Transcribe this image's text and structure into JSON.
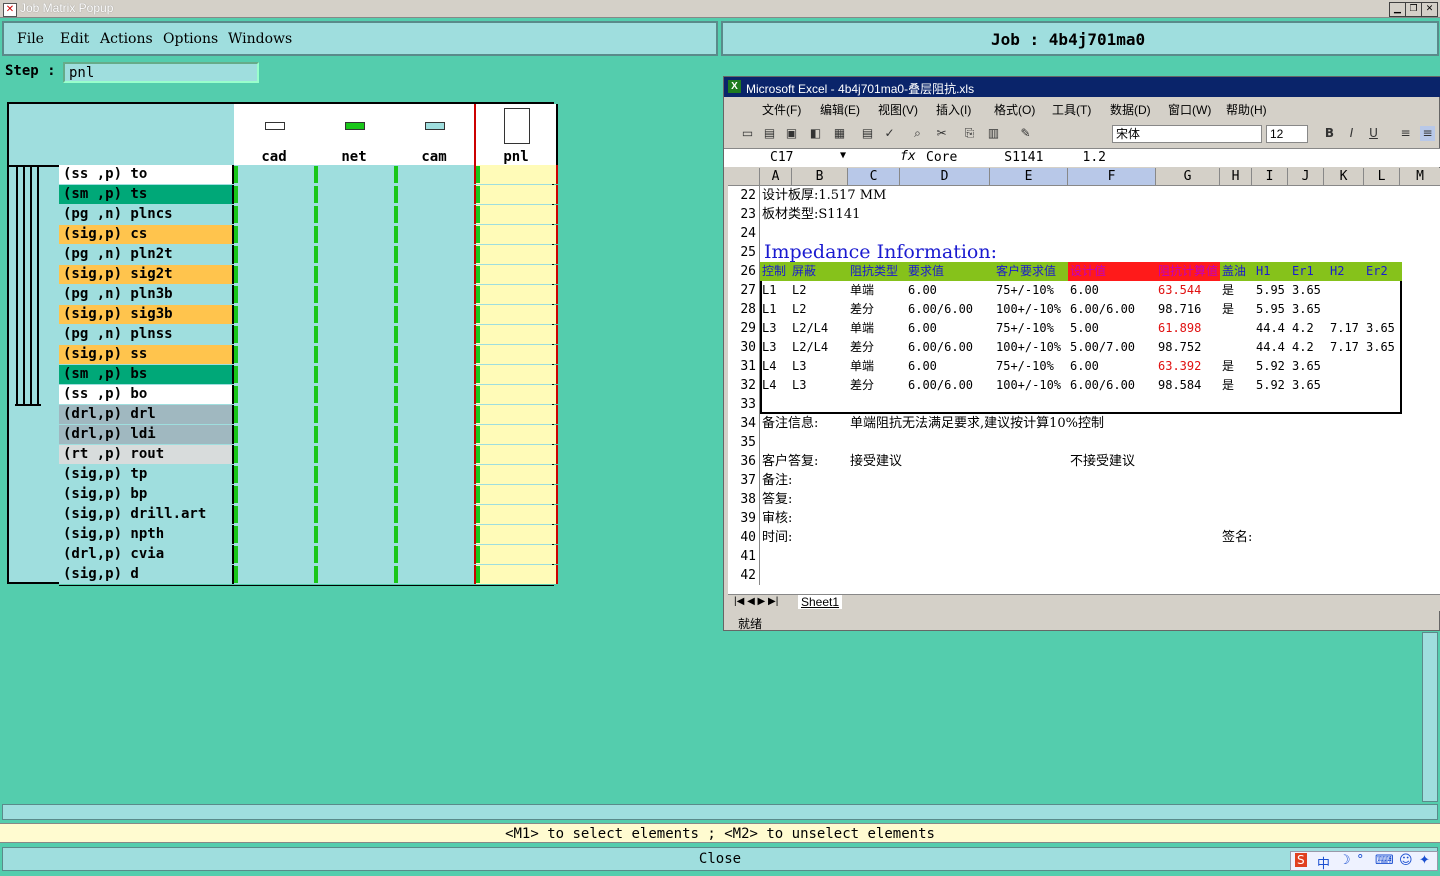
{
  "window": {
    "title": "Job Matrix Popup"
  },
  "menu": {
    "file": "File",
    "edit": "Edit",
    "actions": "Actions",
    "options": "Options",
    "windows": "Windows"
  },
  "job": {
    "label": "Job : 4b4j701ma0"
  },
  "step": {
    "label": "Step :",
    "value": "pnl"
  },
  "matrix": {
    "steps": [
      {
        "name": "cad",
        "icon_color": "#ffffff"
      },
      {
        "name": "net",
        "icon_color": "#19c619"
      },
      {
        "name": "cam",
        "icon_color": "#9fdede"
      },
      {
        "name": "pnl",
        "icon_color": "#ffffff"
      }
    ],
    "layers": [
      {
        "label": "(ss ,p) to",
        "color": "#ffffff"
      },
      {
        "label": "(sm ,p) ts",
        "color": "#00a878"
      },
      {
        "label": "(pg ,n) plncs",
        "color": "#9fdede"
      },
      {
        "label": "(sig,p) cs",
        "color": "#ffc44d"
      },
      {
        "label": "(pg ,n) pln2t",
        "color": "#9fdede"
      },
      {
        "label": "(sig,p) sig2t",
        "color": "#ffc44d"
      },
      {
        "label": "(pg ,n) pln3b",
        "color": "#9fdede"
      },
      {
        "label": "(sig,p) sig3b",
        "color": "#ffc44d"
      },
      {
        "label": "(pg ,n) plnss",
        "color": "#9fdede"
      },
      {
        "label": "(sig,p) ss",
        "color": "#ffc44d"
      },
      {
        "label": "(sm ,p) bs",
        "color": "#00a878"
      },
      {
        "label": "(ss ,p) bo",
        "color": "#ffffff"
      },
      {
        "label": "(drl,p) drl",
        "color": "#a0b8c0"
      },
      {
        "label": "(drl,p) ldi",
        "color": "#a0b8c0"
      },
      {
        "label": "(rt ,p) rout",
        "color": "#d8dcdc"
      },
      {
        "label": "(sig,p) tp",
        "color": "#9fdede"
      },
      {
        "label": "(sig,p) bp",
        "color": "#9fdede"
      },
      {
        "label": "(sig,p) drill.art",
        "color": "#9fdede"
      },
      {
        "label": "(sig,p) npth",
        "color": "#9fdede"
      },
      {
        "label": "(drl,p) cvia",
        "color": "#9fdede"
      },
      {
        "label": "(sig,p) d",
        "color": "#9fdede"
      }
    ]
  },
  "excel": {
    "title": "Microsoft Excel - 4b4j701ma0-叠层阻抗.xls",
    "menu": [
      "文件(F)",
      "编辑(E)",
      "视图(V)",
      "插入(I)",
      "格式(O)",
      "工具(T)",
      "数据(D)",
      "窗口(W)",
      "帮助(H)"
    ],
    "font": "宋体",
    "font_size": "12",
    "cell_ref": "C17",
    "formula": "Core      S1141     1.2",
    "columns": [
      "A",
      "B",
      "C",
      "D",
      "E",
      "F",
      "G",
      "H",
      "I",
      "J",
      "K",
      "L",
      "M"
    ],
    "rows": [
      "22",
      "23",
      "24",
      "25",
      "26",
      "27",
      "28",
      "29",
      "30",
      "31",
      "32",
      "33",
      "34",
      "35",
      "36",
      "37",
      "38",
      "39",
      "40",
      "41",
      "42"
    ],
    "board_thickness": "设计板厚:1.517 MM",
    "board_material": "板材类型:S1141",
    "impedance_title": "Impedance Information:",
    "table_header": [
      "控制",
      "屏蔽",
      "阻抗类型",
      "要求值",
      "客户要求值",
      "设计值",
      "阻抗计算值",
      "盖油",
      "H1",
      "Er1",
      "H2",
      "Er2"
    ],
    "table_rows": [
      [
        "L1",
        "L2",
        "单端",
        "6.00",
        "75+/-10%",
        "6.00",
        "63.544",
        "是",
        "5.95",
        "3.65",
        "",
        ""
      ],
      [
        "L1",
        "L2",
        "差分",
        "6.00/6.00",
        "100+/-10%",
        "6.00/6.00",
        "98.716",
        "是",
        "5.95",
        "3.65",
        "",
        ""
      ],
      [
        "L3",
        "L2/L4",
        "单端",
        "6.00",
        "75+/-10%",
        "5.00",
        "61.898",
        "",
        "44.4",
        "4.2",
        "7.17",
        "3.65"
      ],
      [
        "L3",
        "L2/L4",
        "差分",
        "6.00/6.00",
        "100+/-10%",
        "5.00/7.00",
        "98.752",
        "",
        "44.4",
        "4.2",
        "7.17",
        "3.65"
      ],
      [
        "L4",
        "L3",
        "单端",
        "6.00",
        "75+/-10%",
        "6.00",
        "63.392",
        "是",
        "5.92",
        "3.65",
        "",
        ""
      ],
      [
        "L4",
        "L3",
        "差分",
        "6.00/6.00",
        "100+/-10%",
        "6.00/6.00",
        "98.584",
        "是",
        "5.92",
        "3.65",
        "",
        ""
      ]
    ],
    "red_value_rows": [
      0,
      2,
      4
    ],
    "remark_label": "备注信息:",
    "remark_text": "单端阻抗无法满足要求,建议按计算10%控制",
    "reply_label": "客户答复:",
    "accept": "接受建议",
    "reject": "不接受建议",
    "note": "备注:",
    "answer": "答复:",
    "review": "审核:",
    "time": "时间:",
    "sign": "签名:",
    "sheet_tab": "Sheet1",
    "status": "就绪"
  },
  "footer": {
    "hint": "<M1> to select elements ; <M2> to unselect elements",
    "close": "Close"
  },
  "tray": {
    "ime": "中"
  }
}
